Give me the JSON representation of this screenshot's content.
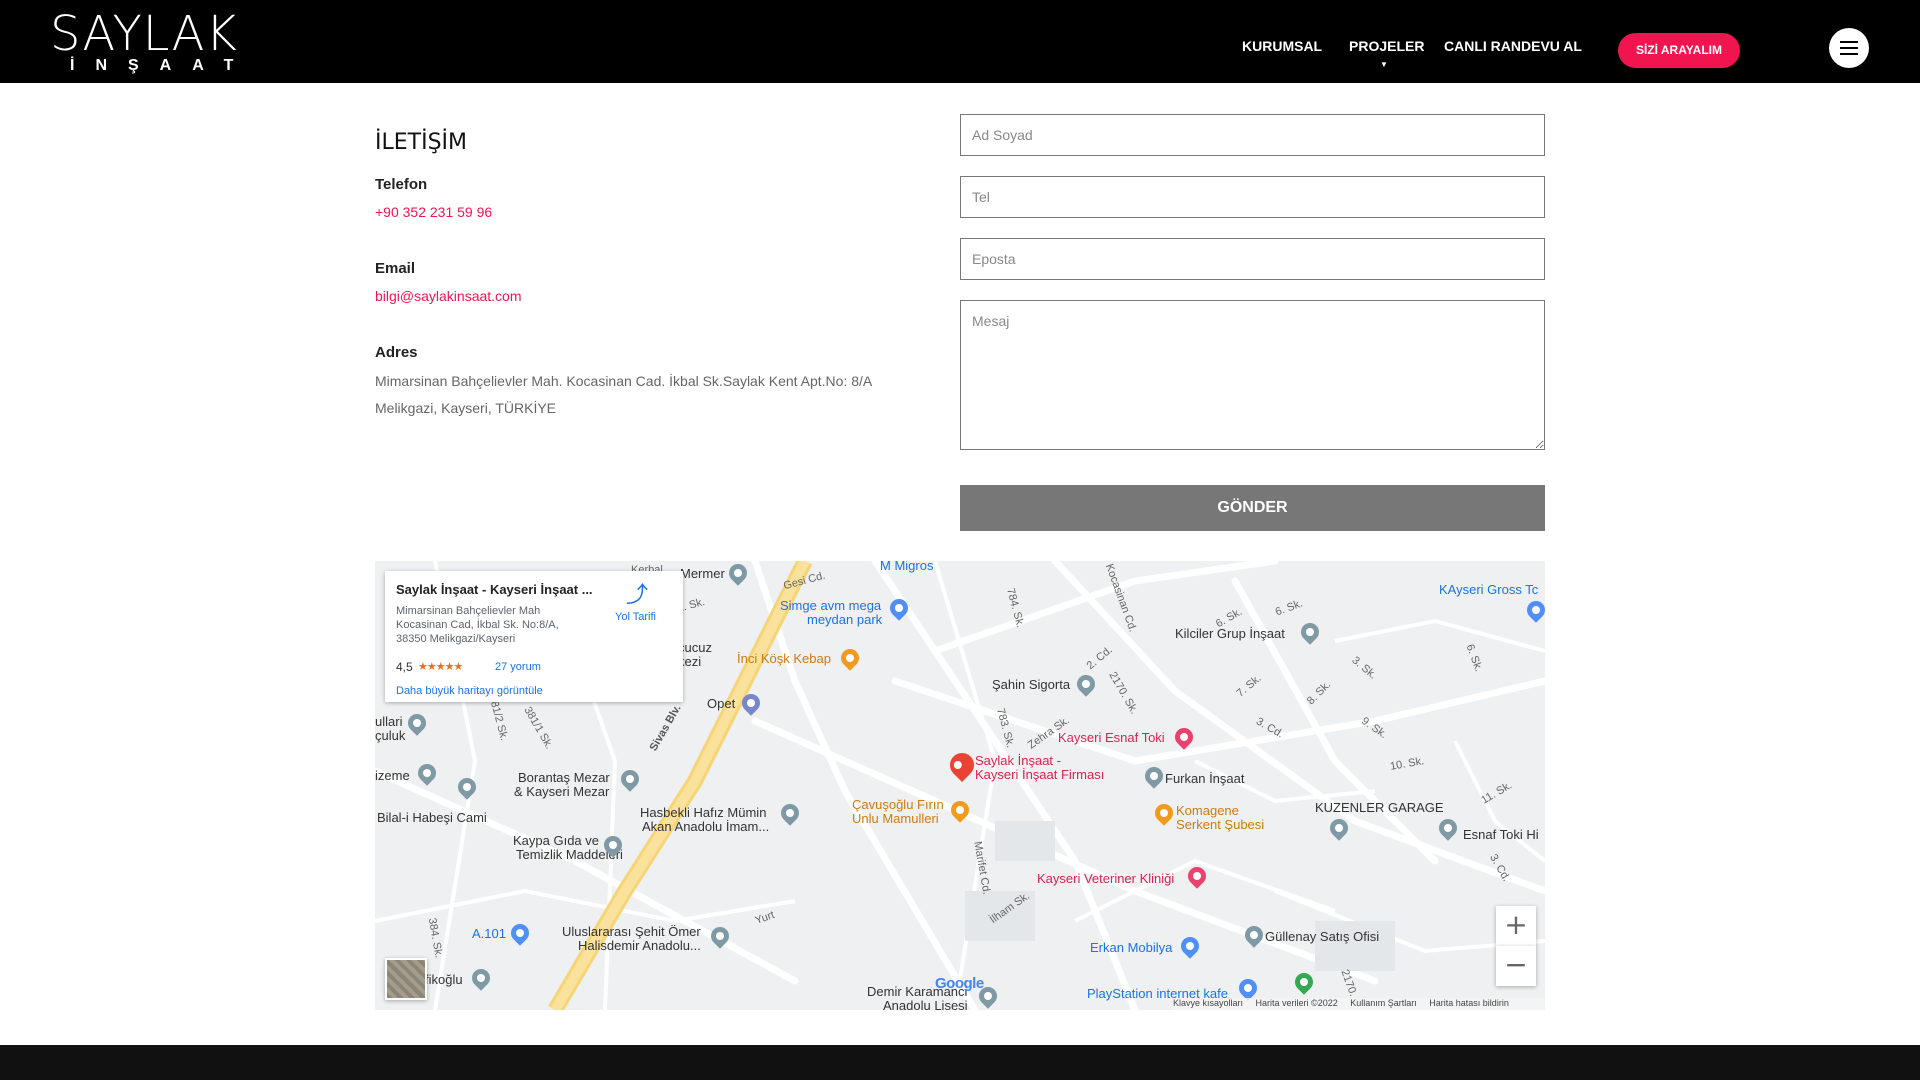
{
  "header": {
    "logo_main": "SAYLAK",
    "logo_sub": "İNŞAAT",
    "nav": [
      "KURUMSAL",
      "PROJELER",
      "CANLI RANDEVU AL"
    ],
    "cta": "SİZİ ARAYALIM",
    "menu_icon": "hamburger-icon"
  },
  "contact": {
    "title": "İLETİŞİM",
    "phone_label": "Telefon",
    "phone": "+90 352 231 59 96",
    "email_label": "Email",
    "email": "bilgi@saylakinsaat.com",
    "address_label": "Adres",
    "address_line1": "Mimarsinan Bahçelievler Mah. Kocasinan Cad. İkbal Sk.Saylak Kent Apt.No: 8/A",
    "address_line2": "Melikgazi, Kayseri, TÜRKİYE"
  },
  "form": {
    "name_placeholder": "Ad Soyad",
    "phone_placeholder": "Tel",
    "email_placeholder": "Eposta",
    "message_placeholder": "Mesaj",
    "submit": "GÖNDER",
    "accent_color": "#f0154f"
  },
  "map": {
    "card": {
      "title": "Saylak İnşaat - Kayseri İnşaat ...",
      "address": "Mimarsinan Bahçelievler Mah Kocasinan Cad, İkbal Sk. No:8/A, 38350 Melikgazi/Kayseri",
      "directions": "Yol Tarifi",
      "rating": "4,5",
      "stars": "★★★★★",
      "reviews": "27 yorum",
      "bigger_map": "Daha büyük haritayı görüntüle"
    },
    "labels": {
      "mermer": "Mermer",
      "migros": "M Migros",
      "simge": "Simge avm mega",
      "simge2": "meydan park",
      "kerbal": "Kerbal",
      "inci": "İnci Köşk Kebap",
      "cucuz": "cucuz",
      "kezi": "kezi",
      "opet": "Opet",
      "sahin": "Şahin Sigorta",
      "kilciler": "Kilciler Grup İnşaat",
      "kayseri_gross": "KAyseri Gross Tc",
      "esnaf_toki": "Kayseri Esnaf Toki",
      "saylak_pin": "Saylak İnşaat -",
      "saylak_pin2": "Kayseri İnşaat Firması",
      "furkan": "Furkan İnşaat",
      "kuzenler": "KUZENLER GARAGE",
      "esnaf_toki_hi": "Esnaf Toki Hi",
      "komagene": "Komagene",
      "komagene2": "Serkent Şubesi",
      "cavusoglu": "Çavuşoğlu Fırın",
      "cavusoglu2": "Unlu Mamulleri",
      "borantas": "Borantaş Mezar",
      "borantas2": "& Kayseri Mezar",
      "hasbekli": "Hasbekli Hafız Mümin",
      "hasbekli2": "Akan Anadolu İmam...",
      "kaypa": "Kaypa Gıda ve",
      "kaypa2": "Temizlik Maddeleri",
      "bilal": "Bilal-i Habeşi Cami",
      "izeme": "izeme",
      "ullari": "ullari",
      "culuk": "çuluk",
      "veteriner": "Kayseri Veteriner Kliniği",
      "erkan": "Erkan Mobilya",
      "gullenay": "Güllenay Satış Ofisi",
      "a101": "A.101",
      "sehit": "Uluslararası Şehit Ömer",
      "sehit2": "Halisdemir Anadolu...",
      "demir": "Demir Karamanci",
      "demir2": "Anadolu Lisesi",
      "playstation": "PlayStation internet kafe",
      "fikoglu": "fikoğlu",
      "gesi": "Gesi Cd.",
      "sivas": "Sivas Blv.",
      "kocasinan": "Kocasinan Cd.",
      "zehra": "Zehra Sk.",
      "ilham": "İlham Sk.",
      "marifet": "Marifet Cd.",
      "yurt": "Yurt",
      "s381": "381. Sk.",
      "s3812": "381/2 Sk.",
      "s3811": "381/1 Sk.",
      "s384": "384. Sk.",
      "s784": "784. Sk.",
      "s783": "783. Sk.",
      "s2cd": "2. Cd.",
      "s2170": "2170. Sk.",
      "s6sk": "6. Sk.",
      "s6sk2": "6. Sk.",
      "s7sk": "7. Sk.",
      "s8sk": "8. Sk.",
      "s3sk": "3. Sk.",
      "s3cd": "3. Cd.",
      "s9sk": "9. Sk.",
      "s10sk": "10. Sk.",
      "s11sk": "11. Sk.",
      "s3cd2": "3. Cd.",
      "s2170b": "2170."
    },
    "zoom_in": "+",
    "zoom_out": "−",
    "google": "Google",
    "attribution": [
      "Klavye kısayolları",
      "Harita verileri ©2022",
      "Kullanım Şartları",
      "Harita hatası bildirin"
    ]
  }
}
